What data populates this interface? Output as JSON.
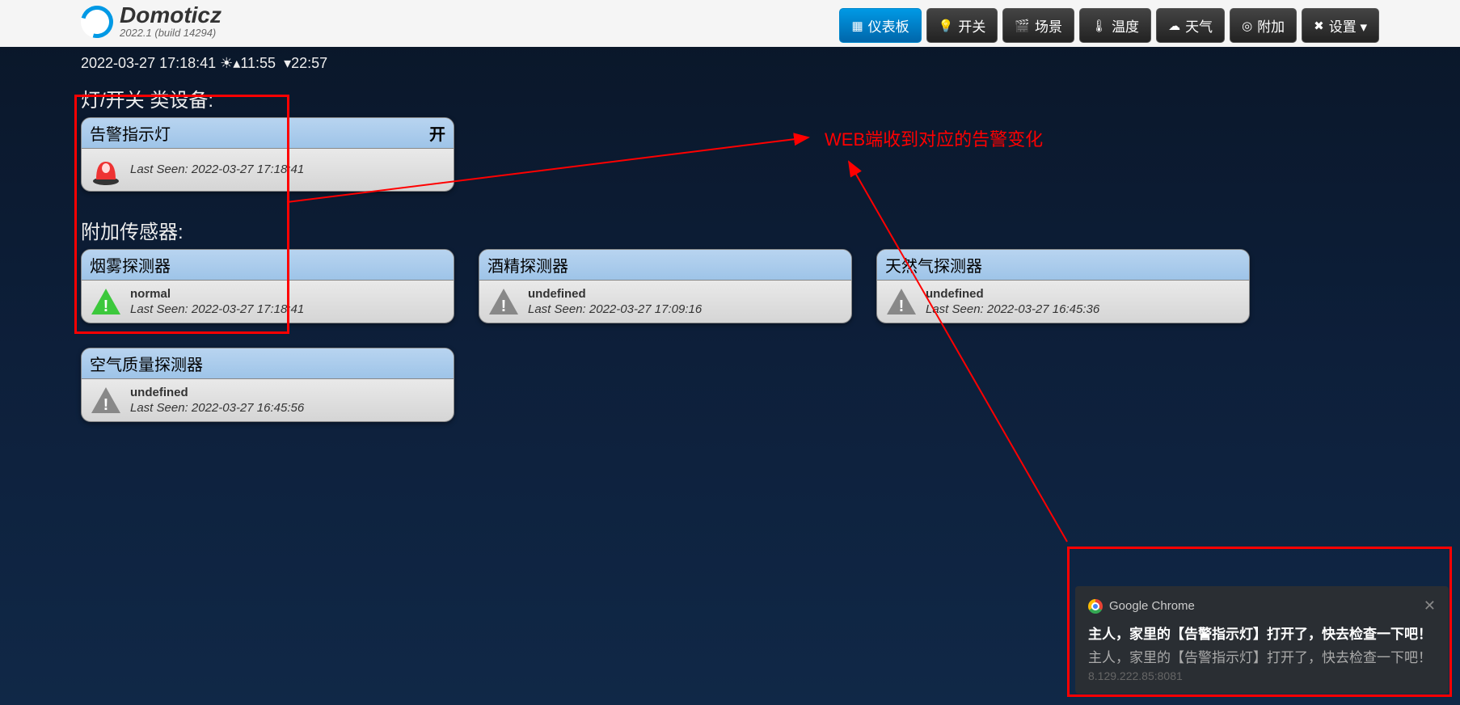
{
  "app": {
    "name": "Domoticz",
    "version": "2022.1 (build 14294)"
  },
  "sunrise": {
    "datetime": "2022-03-27 17:18:41",
    "sunrise": "11:55",
    "sunset": "22:57"
  },
  "nav": [
    {
      "label": "仪表板",
      "icon": "▦",
      "active": true
    },
    {
      "label": "开关",
      "icon": "💡"
    },
    {
      "label": "场景",
      "icon": "🎬"
    },
    {
      "label": "温度",
      "icon": "🌡"
    },
    {
      "label": "天气",
      "icon": "☁"
    },
    {
      "label": "附加",
      "icon": "◎"
    },
    {
      "label": "设置 ▾",
      "icon": "✖"
    }
  ],
  "sections": {
    "switches": {
      "title": "灯/开关 类设备:",
      "items": [
        {
          "title": "告警指示灯",
          "state": "开",
          "icon": "siren",
          "status": "",
          "lastseen_label": "Last Seen:",
          "lastseen": "2022-03-27 17:18:41"
        }
      ]
    },
    "sensors": {
      "title": "附加传感器:",
      "rows": [
        [
          {
            "title": "烟雾探测器",
            "icon": "tri-green",
            "status": "normal",
            "lastseen_label": "Last Seen:",
            "lastseen": "2022-03-27 17:18:41"
          },
          {
            "title": "酒精探测器",
            "icon": "tri-grey",
            "status": "undefined",
            "lastseen_label": "Last Seen:",
            "lastseen": "2022-03-27 17:09:16"
          },
          {
            "title": "天然气探测器",
            "icon": "tri-grey",
            "status": "undefined",
            "lastseen_label": "Last Seen:",
            "lastseen": "2022-03-27 16:45:36"
          }
        ],
        [
          {
            "title": "空气质量探测器",
            "icon": "tri-grey",
            "status": "undefined",
            "lastseen_label": "Last Seen:",
            "lastseen": "2022-03-27 16:45:56"
          }
        ]
      ]
    }
  },
  "annotation": "WEB端收到对应的告警变化",
  "notification": {
    "app": "Google Chrome",
    "title": "主人，家里的【告警指示灯】打开了，快去检查一下吧！",
    "body": "主人，家里的【告警指示灯】打开了，快去检查一下吧！",
    "source": "8.129.222.85:8081"
  }
}
